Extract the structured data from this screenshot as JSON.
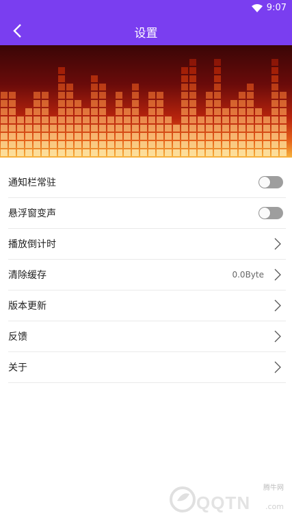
{
  "status_bar": {
    "time": "9:07",
    "wifi_icon": "wifi-icon"
  },
  "header": {
    "title": "设置",
    "back_icon": "back-arrow-icon"
  },
  "colors": {
    "accent": "#7a3ef0",
    "toggle_off": "#9e9e9e"
  },
  "settings": [
    {
      "label": "通知栏常驻",
      "type": "toggle",
      "on": false
    },
    {
      "label": "悬浮窗变声",
      "type": "toggle",
      "on": false
    },
    {
      "label": "播放倒计时",
      "type": "link"
    },
    {
      "label": "清除缓存",
      "type": "link",
      "value": "0.0Byte"
    },
    {
      "label": "版本更新",
      "type": "link"
    },
    {
      "label": "反馈",
      "type": "link"
    },
    {
      "label": "关于",
      "type": "link"
    }
  ],
  "watermark": {
    "brand": "QQTN",
    "small": "腾牛网",
    "suffix": ".com"
  }
}
